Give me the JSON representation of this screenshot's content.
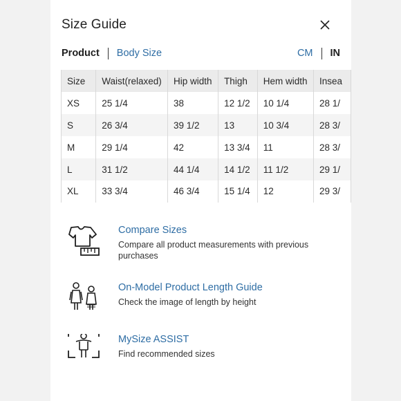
{
  "header": {
    "title": "Size Guide",
    "close_icon": "close-icon"
  },
  "tabs": {
    "product": "Product",
    "body_size": "Body Size"
  },
  "units": {
    "cm": "CM",
    "in": "IN"
  },
  "table": {
    "columns": [
      "Size",
      "Waist(relaxed)",
      "Hip width",
      "Thigh",
      "Hem width",
      "Insea"
    ],
    "rows": [
      [
        "XS",
        "25 1/4",
        "38",
        "12 1/2",
        "10 1/4",
        "28 1/"
      ],
      [
        "S",
        "26 3/4",
        "39 1/2",
        "13",
        "10 3/4",
        "28 3/"
      ],
      [
        "M",
        "29 1/4",
        "42",
        "13 3/4",
        "11",
        "28 3/"
      ],
      [
        "L",
        "31 1/2",
        "44 1/4",
        "14 1/2",
        "11 1/2",
        "29 1/"
      ],
      [
        "XL",
        "33 3/4",
        "46 3/4",
        "15 1/4",
        "12",
        "29 3/"
      ]
    ]
  },
  "features": [
    {
      "icon": "tshirt-ruler-icon",
      "title": "Compare Sizes",
      "desc": "Compare all product measurements with previous purchases"
    },
    {
      "icon": "models-icon",
      "title": "On-Model Product Length Guide",
      "desc": "Check the image of length by height"
    },
    {
      "icon": "body-scan-icon",
      "title": "MySize ASSIST",
      "desc": "Find recommended sizes"
    }
  ],
  "colors": {
    "link": "#2e6da4",
    "header_bg": "#ebebeb",
    "stripe_bg": "#f4f4f4",
    "page_bg": "#f2f2f2"
  }
}
